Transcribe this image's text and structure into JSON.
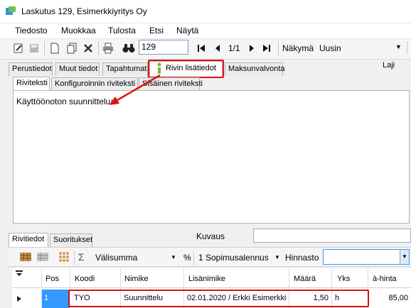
{
  "window": {
    "title": "Laskutus 129, Esimerkkiyritys Oy"
  },
  "menu": [
    "Tiedosto",
    "Muokkaa",
    "Tulosta",
    "Etsi",
    "Näytä"
  ],
  "toolbar": {
    "record_number": "129",
    "page_indicator": "1/1",
    "view_label": "Näkymä",
    "view_value": "Uusin"
  },
  "main_tabs": [
    "Perustiedot",
    "Muut tiedot",
    "Tapahtumat",
    "Rivin lisätiedot",
    "Maksunvalvonta"
  ],
  "laji_label": "Laji",
  "sub_tabs": [
    "Riviteksti",
    "Konfiguroinnin riviteksti",
    "Sisäinen riviteksti"
  ],
  "row_text": "Käyttöönoton suunnittelua",
  "lower_tabs": [
    "Rivitiedot",
    "Suoritukset"
  ],
  "kuvaus_label": "Kuvaus",
  "lower_toolbar": {
    "subtotal_label": "Välisumma",
    "percent": "%",
    "discount_label": "1 Sopimusalennus",
    "price_list_label": "Hinnasto"
  },
  "grid": {
    "columns": [
      "Pos",
      "Koodi",
      "Nimike",
      "Lisänimike",
      "Määrä",
      "Yks",
      "à-hinta"
    ],
    "rows": [
      {
        "pos": "1",
        "koodi": "TYO",
        "nimike": "Suunnittelu",
        "lisanimike": "02.01.2020 / Erkki Esimerkki",
        "maara": "1,50",
        "yks": "h",
        "hinta": "85,00"
      }
    ]
  },
  "colors": {
    "highlight": "#e01010",
    "selection": "#3399ff"
  }
}
